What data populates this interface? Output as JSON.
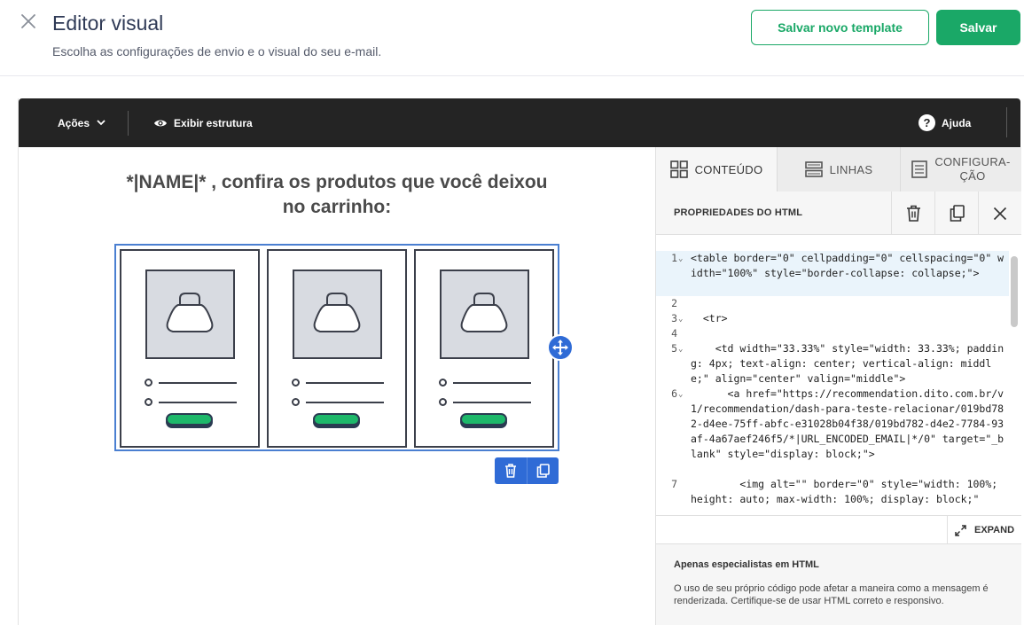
{
  "header": {
    "title": "Editor visual",
    "subtitle": "Escolha as configurações de envio e o visual do seu e-mail.",
    "save_template_label": "Salvar novo template",
    "save_label": "Salvar"
  },
  "toolbar": {
    "acoes_label": "Ações",
    "estrutura_label": "Exibir estrutura",
    "ajuda_label": "Ajuda",
    "help_glyph": "?"
  },
  "canvas": {
    "heading": "*|NAME|* , confira os produtos que você deixou no carrinho:"
  },
  "panel": {
    "tabs": [
      {
        "label": "CONTEÚDO",
        "icon": "grid-icon"
      },
      {
        "label": "LINHAS",
        "icon": "rows-icon"
      },
      {
        "label": "CONFIGURA-\nÇÃO",
        "icon": "document-icon"
      }
    ],
    "props_title": "PROPRIEDADES DO HTML",
    "expand_label": "EXPAND",
    "warning_title": "Apenas especialistas em HTML",
    "warning_text": "O uso de seu próprio código pode afetar a maneira como a mensagem é renderizada. Certifique-se de usar HTML correto e responsivo."
  },
  "code": {
    "lines": [
      {
        "n": "1",
        "fold": true,
        "text": "<table border=\"0\" cellpadding=\"0\" cellspacing=\"0\" width=\"100%\" style=\"border-collapse: collapse;\">"
      },
      {
        "n": "2",
        "fold": false,
        "text": ""
      },
      {
        "n": "3",
        "fold": true,
        "text": "  <tr>"
      },
      {
        "n": "4",
        "fold": false,
        "text": ""
      },
      {
        "n": "5",
        "fold": true,
        "text": "    <td width=\"33.33%\" style=\"width: 33.33%; padding: 4px; text-align: center; vertical-align: middle;\" align=\"center\" valign=\"middle\">"
      },
      {
        "n": "6",
        "fold": true,
        "text": "      <a href=\"https://recommendation.dito.com.br/v1/recommendation/dash-para-teste-relacionar/019bd782-d4ee-75ff-abfc-e31028b04f38/019bd782-d4e2-7784-93af-4a67aef246f5/*|URL_ENCODED_EMAIL|*/0\" target=\"_blank\" style=\"display: block;\">"
      },
      {
        "n": "7",
        "fold": false,
        "text": "        <img alt=\"\" border=\"0\" style=\"width: 100%; height: auto; max-width: 100%; display: block;\""
      }
    ]
  },
  "colors": {
    "brand_green": "#1aa867",
    "selection_blue": "#2f6bd6",
    "toolbar_bg": "#242424"
  }
}
